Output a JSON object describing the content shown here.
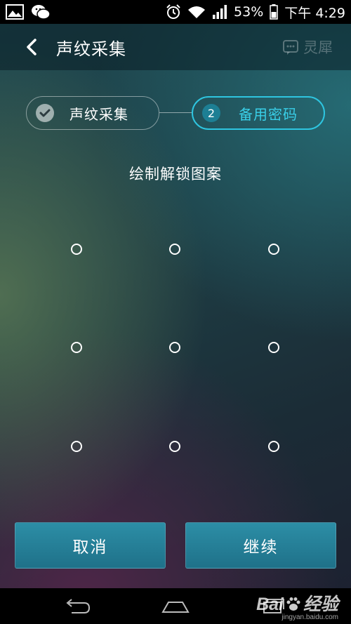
{
  "status_bar": {
    "battery": "53%",
    "time_label": "下午 4:29",
    "icons": [
      "gallery-icon",
      "wechat-icon",
      "alarm-icon",
      "wifi-icon",
      "signal-icon",
      "battery-icon"
    ]
  },
  "header": {
    "title": "声纹采集",
    "brand": "灵犀"
  },
  "steps": [
    {
      "label": "声纹采集",
      "state": "completed"
    },
    {
      "number": "2",
      "label": "备用密码",
      "state": "active"
    }
  ],
  "pattern": {
    "title": "绘制解锁图案",
    "dots": 9
  },
  "buttons": {
    "cancel": "取消",
    "continue": "继续"
  },
  "watermark": {
    "brand_a": "Bai",
    "brand_b": "经验",
    "url": "jingyan.baidu.com"
  },
  "colors": {
    "accent": "#2ec5e0",
    "button": "#2481a0"
  }
}
